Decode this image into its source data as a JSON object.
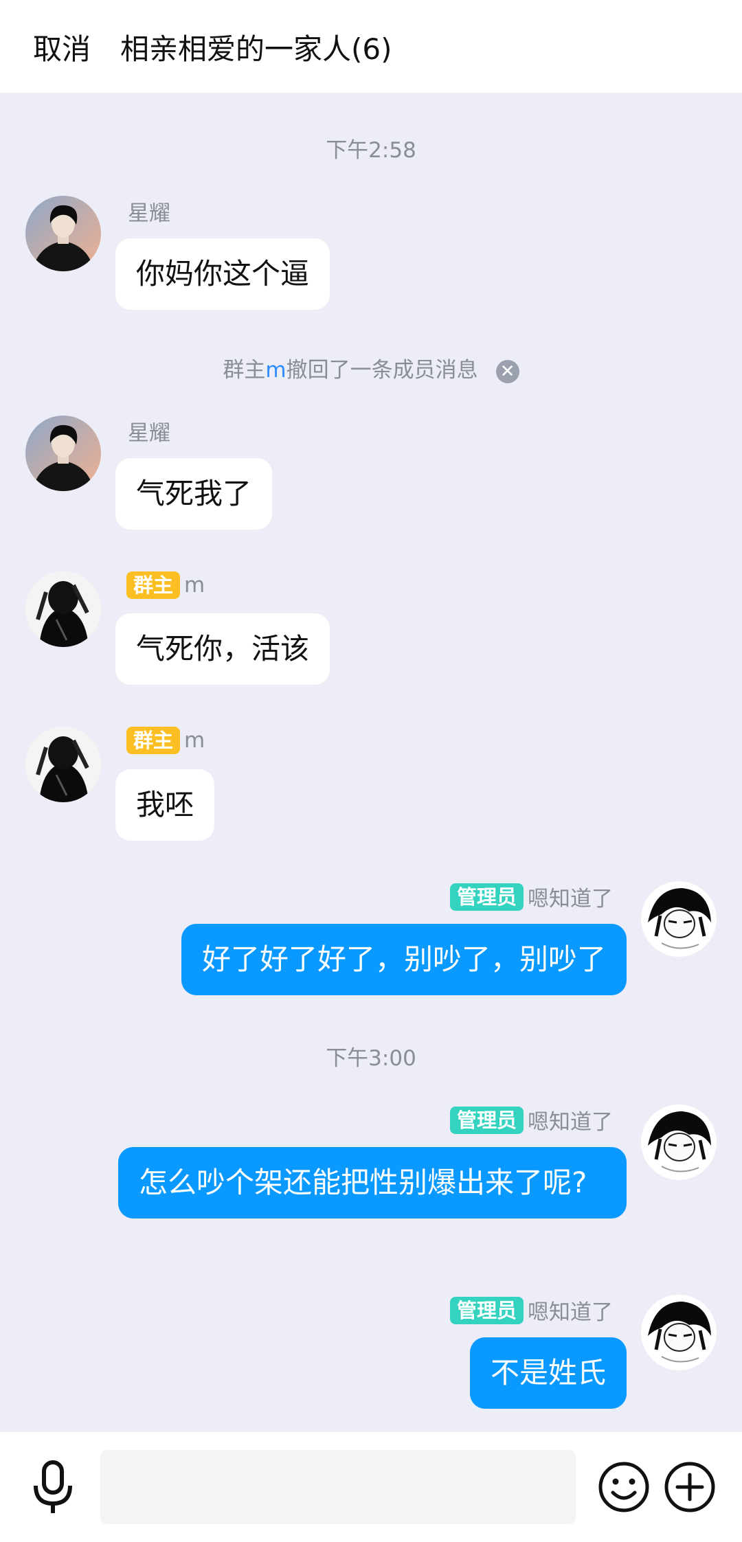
{
  "header": {
    "cancel": "取消",
    "title": "相亲相爱的一家人(6)"
  },
  "time1": "下午2:58",
  "time2": "下午3:00",
  "recall": {
    "prefix": "群主",
    "name": "m",
    "suffix": "撤回了一条成员消息",
    "close_icon": "close-icon"
  },
  "messages": [
    {
      "sender": "星耀",
      "text": "你妈你这个逼"
    },
    {
      "sender": "星耀",
      "text": "气死我了"
    },
    {
      "badge": "群主",
      "sender": "m",
      "text": "气死你，活该"
    },
    {
      "badge": "群主",
      "sender": "m",
      "text": "我呸"
    },
    {
      "badge": "管理员",
      "sender": "嗯知道了",
      "text": "好了好了好了，别吵了，别吵了"
    },
    {
      "badge": "管理员",
      "sender": "嗯知道了",
      "text": "怎么吵个架还能把性别爆出来了呢?"
    },
    {
      "badge": "管理员",
      "sender": "嗯知道了",
      "text": "不是姓氏"
    }
  ],
  "input": {
    "placeholder": ""
  },
  "colors": {
    "out_bubble": "#0a99ff",
    "owner_badge": "#fbbf24",
    "admin_badge": "#34d3c0",
    "background": "#ecedf6"
  },
  "icons": {
    "mic": "microphone-icon",
    "emoji": "emoji-icon",
    "plus": "plus-icon"
  }
}
